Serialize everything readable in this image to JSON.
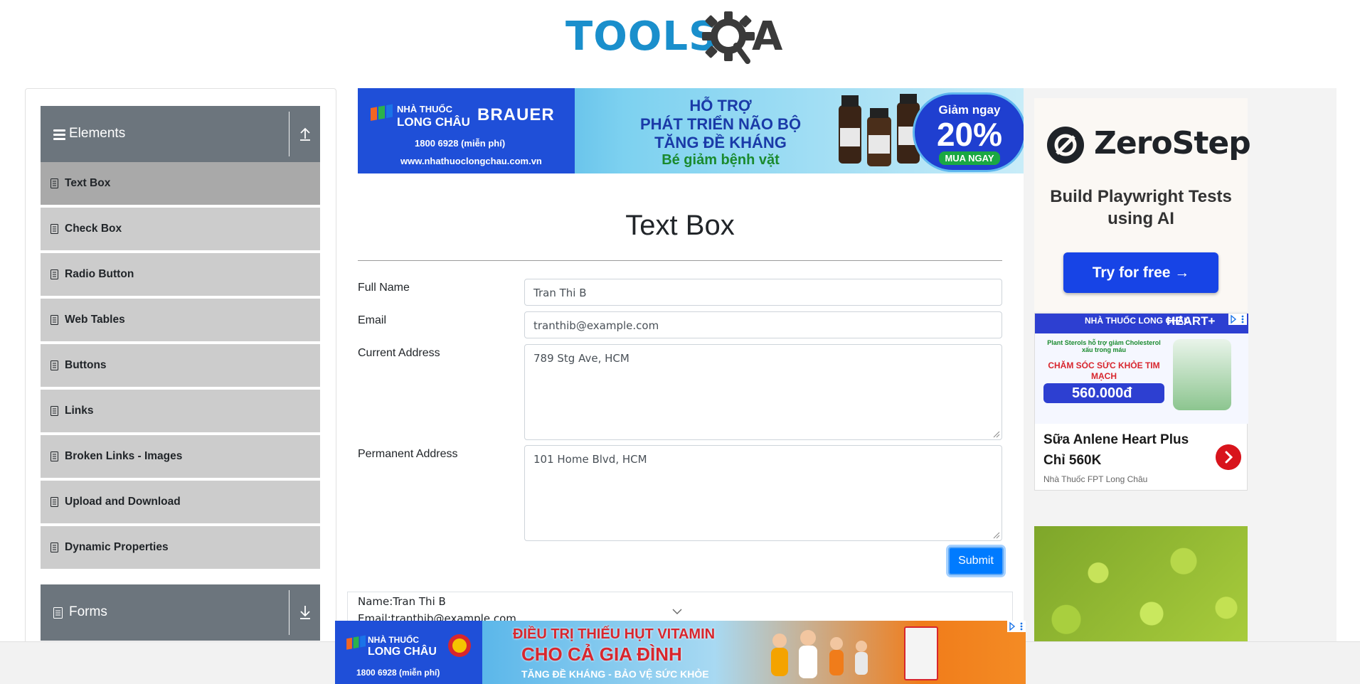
{
  "header": {
    "logo_text": "TOOLS",
    "logo_suffix": "A"
  },
  "sidebar": {
    "groups": [
      {
        "title": "Elements",
        "expanded": true,
        "items": [
          {
            "label": "Text Box",
            "active": true
          },
          {
            "label": "Check Box"
          },
          {
            "label": "Radio Button"
          },
          {
            "label": "Web Tables"
          },
          {
            "label": "Buttons"
          },
          {
            "label": "Links"
          },
          {
            "label": "Broken Links - Images"
          },
          {
            "label": "Upload and Download"
          },
          {
            "label": "Dynamic Properties"
          }
        ]
      },
      {
        "title": "Forms",
        "expanded": false
      }
    ]
  },
  "main": {
    "title": "Text Box",
    "fields": {
      "full_name": {
        "label": "Full Name",
        "value": "Tran Thi B"
      },
      "email": {
        "label": "Email",
        "value": "tranthib@example.com"
      },
      "current_address": {
        "label": "Current Address",
        "value": "789 Stg Ave, HCM"
      },
      "permanent_address": {
        "label": "Permanent Address",
        "value": "101 Home Blvd, HCM"
      }
    },
    "submit_label": "Submit",
    "output": {
      "name": "Name:Tran Thi B",
      "email": "Email:tranthib@example.com"
    }
  },
  "ads": {
    "top_banner": {
      "brand_line1": "NHÀ THUỐC",
      "brand_line2": "LONG CHÂU",
      "brand_product": "BRAUER",
      "phone": "1800 6928 (miễn phí)",
      "website": "www.nhathuoclongchau.com.vn",
      "headline1": "HỖ TRỢ",
      "headline2": "PHÁT TRIỂN NÃO BỘ",
      "headline3": "TĂNG ĐỀ KHÁNG",
      "headline4": "Bé giảm bệnh vặt",
      "badge_top": "Giảm ngay",
      "badge_percent": "20%",
      "badge_cta": "MUA NGAY"
    },
    "zerostep": {
      "name": "ZeroStep",
      "tagline": "Build Playwright Tests using AI",
      "cta": "Try for free →"
    },
    "heart": {
      "brand": "NHÀ THUỐC LONG CHÂU",
      "product": "HEART+",
      "blurb": "Plant Sterols hỗ trợ giảm Cholesterol xấu trong máu",
      "headline": "CHĂM SÓC SỨC KHỎE TIM MẠCH",
      "price": "560.000đ",
      "title": "Sữa Anlene Heart Plus Chỉ 560K",
      "source": "Nhà Thuốc FPT Long Châu"
    },
    "bottom_banner": {
      "brand_line1": "NHÀ THUỐC",
      "brand_line2": "LONG CHÂU",
      "phone": "1800 6928 (miễn phí)",
      "headline1": "ĐIỀU TRỊ THIẾU HỤT VITAMIN",
      "headline2": "CHO CẢ GIA ĐÌNH",
      "headline3": "TĂNG ĐỀ KHÁNG - BẢO VỆ SỨC KHỎE"
    }
  },
  "colors": {
    "accent": "#007bff",
    "sidebar_header": "#6c757d",
    "sidebar_item": "#cccccc",
    "sidebar_item_active": "#a9a9a9",
    "logo_blue": "#1a8fcc"
  }
}
